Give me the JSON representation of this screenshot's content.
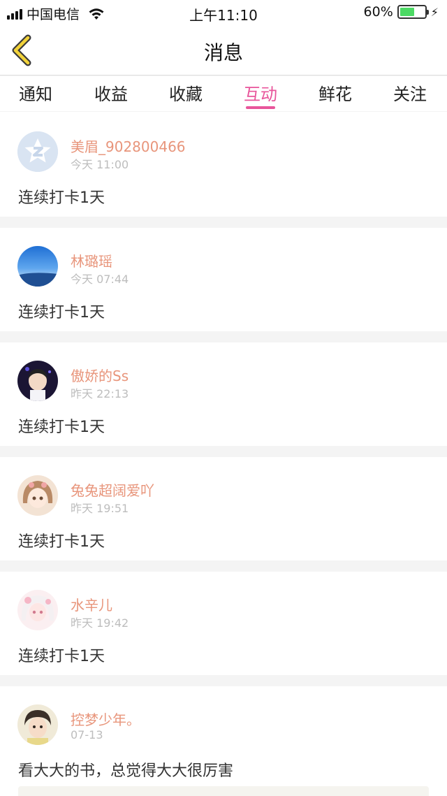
{
  "status": {
    "carrier": "中国电信",
    "time": "上午11:10",
    "battery_percent": "60%",
    "battery_level": 0.6
  },
  "header": {
    "title": "消息"
  },
  "tabs": [
    {
      "label": "通知",
      "active": false
    },
    {
      "label": "收益",
      "active": false
    },
    {
      "label": "收藏",
      "active": false
    },
    {
      "label": "互动",
      "active": true
    },
    {
      "label": "鲜花",
      "active": false
    },
    {
      "label": "关注",
      "active": false
    }
  ],
  "messages": [
    {
      "name": "美眉_902800466",
      "time": "今天 11:00",
      "content": "连续打卡1天",
      "avatar": "default-avatar-icon"
    },
    {
      "name": "林璐瑶",
      "time": "今天 07:44",
      "content": "连续打卡1天",
      "avatar": "sky-photo-avatar"
    },
    {
      "name": "傲娇的Ss",
      "time": "昨天 22:13",
      "content": "连续打卡1天",
      "avatar": "cartoon-boy-avatar"
    },
    {
      "name": "兔兔超阔爱吖",
      "time": "昨天 19:51",
      "content": "连续打卡1天",
      "avatar": "anime-girl-avatar"
    },
    {
      "name": "水辛儿",
      "time": "昨天 19:42",
      "content": "连续打卡1天",
      "avatar": "anime-pink-avatar"
    },
    {
      "name": "控梦少年。",
      "time": "07-13",
      "content": "看大大的书，总觉得大大很厉害",
      "avatar": "photo-boy-avatar"
    }
  ],
  "colors": {
    "accent": "#e8559b",
    "username": "#e8957b",
    "timestamp": "#bdbdbd",
    "separator": "#f4f4f4"
  }
}
